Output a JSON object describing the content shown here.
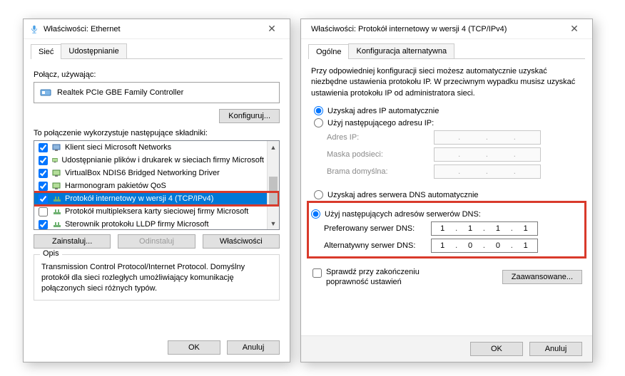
{
  "dlg1": {
    "title": "Właściwości: Ethernet",
    "tabs": {
      "network": "Sieć",
      "sharing": "Udostępnianie"
    },
    "connect_using": "Połącz, używając:",
    "adapter": "Realtek PCIe GBE Family Controller",
    "configure": "Konfiguruj...",
    "components_label": "To połączenie wykorzystuje następujące składniki:",
    "items": [
      {
        "label": "Klient sieci Microsoft Networks",
        "checked": true,
        "icon": "client"
      },
      {
        "label": "Udostępnianie plików i drukarek w sieciach firmy Microsoft",
        "checked": true,
        "icon": "share"
      },
      {
        "label": "VirtualBox NDIS6 Bridged Networking Driver",
        "checked": true,
        "icon": "share"
      },
      {
        "label": "Harmonogram pakietów QoS",
        "checked": true,
        "icon": "share"
      },
      {
        "label": "Protokół internetowy w wersji 4 (TCP/IPv4)",
        "checked": true,
        "icon": "proto",
        "selected": true
      },
      {
        "label": "Protokół multipleksera karty sieciowej firmy Microsoft",
        "checked": false,
        "icon": "proto"
      },
      {
        "label": "Sterownik protokołu LLDP firmy Microsoft",
        "checked": true,
        "icon": "proto"
      }
    ],
    "install": "Zainstaluj...",
    "uninstall": "Odinstaluj",
    "properties": "Właściwości",
    "desc_title": "Opis",
    "desc_text": "Transmission Control Protocol/Internet Protocol. Domyślny protokół dla sieci rozległych umożliwiający komunikację połączonych sieci różnych typów.",
    "ok": "OK",
    "cancel": "Anuluj"
  },
  "dlg2": {
    "title": "Właściwości: Protokół internetowy w wersji 4 (TCP/IPv4)",
    "tabs": {
      "general": "Ogólne",
      "altconfig": "Konfiguracja alternatywna"
    },
    "info": "Przy odpowiedniej konfiguracji sieci możesz automatycznie uzyskać niezbędne ustawienia protokołu IP. W przeciwnym wypadku musisz uzyskać ustawienia protokołu IP od administratora sieci.",
    "ip_auto": "Uzyskaj adres IP automatycznie",
    "ip_manual": "Użyj następującego adresu IP:",
    "ip_addr": "Adres IP:",
    "mask": "Maska podsieci:",
    "gateway": "Brama domyślna:",
    "dns_auto": "Uzyskaj adres serwera DNS automatycznie",
    "dns_manual": "Użyj następujących adresów serwerów DNS:",
    "pref_dns": "Preferowany serwer DNS:",
    "alt_dns": "Alternatywny serwer DNS:",
    "pref_dns_val": [
      "1",
      "1",
      "1",
      "1"
    ],
    "alt_dns_val": [
      "1",
      "0",
      "0",
      "1"
    ],
    "validate": "Sprawdź przy zakończeniu poprawność ustawień",
    "advanced": "Zaawansowane...",
    "ok": "OK",
    "cancel": "Anuluj"
  }
}
